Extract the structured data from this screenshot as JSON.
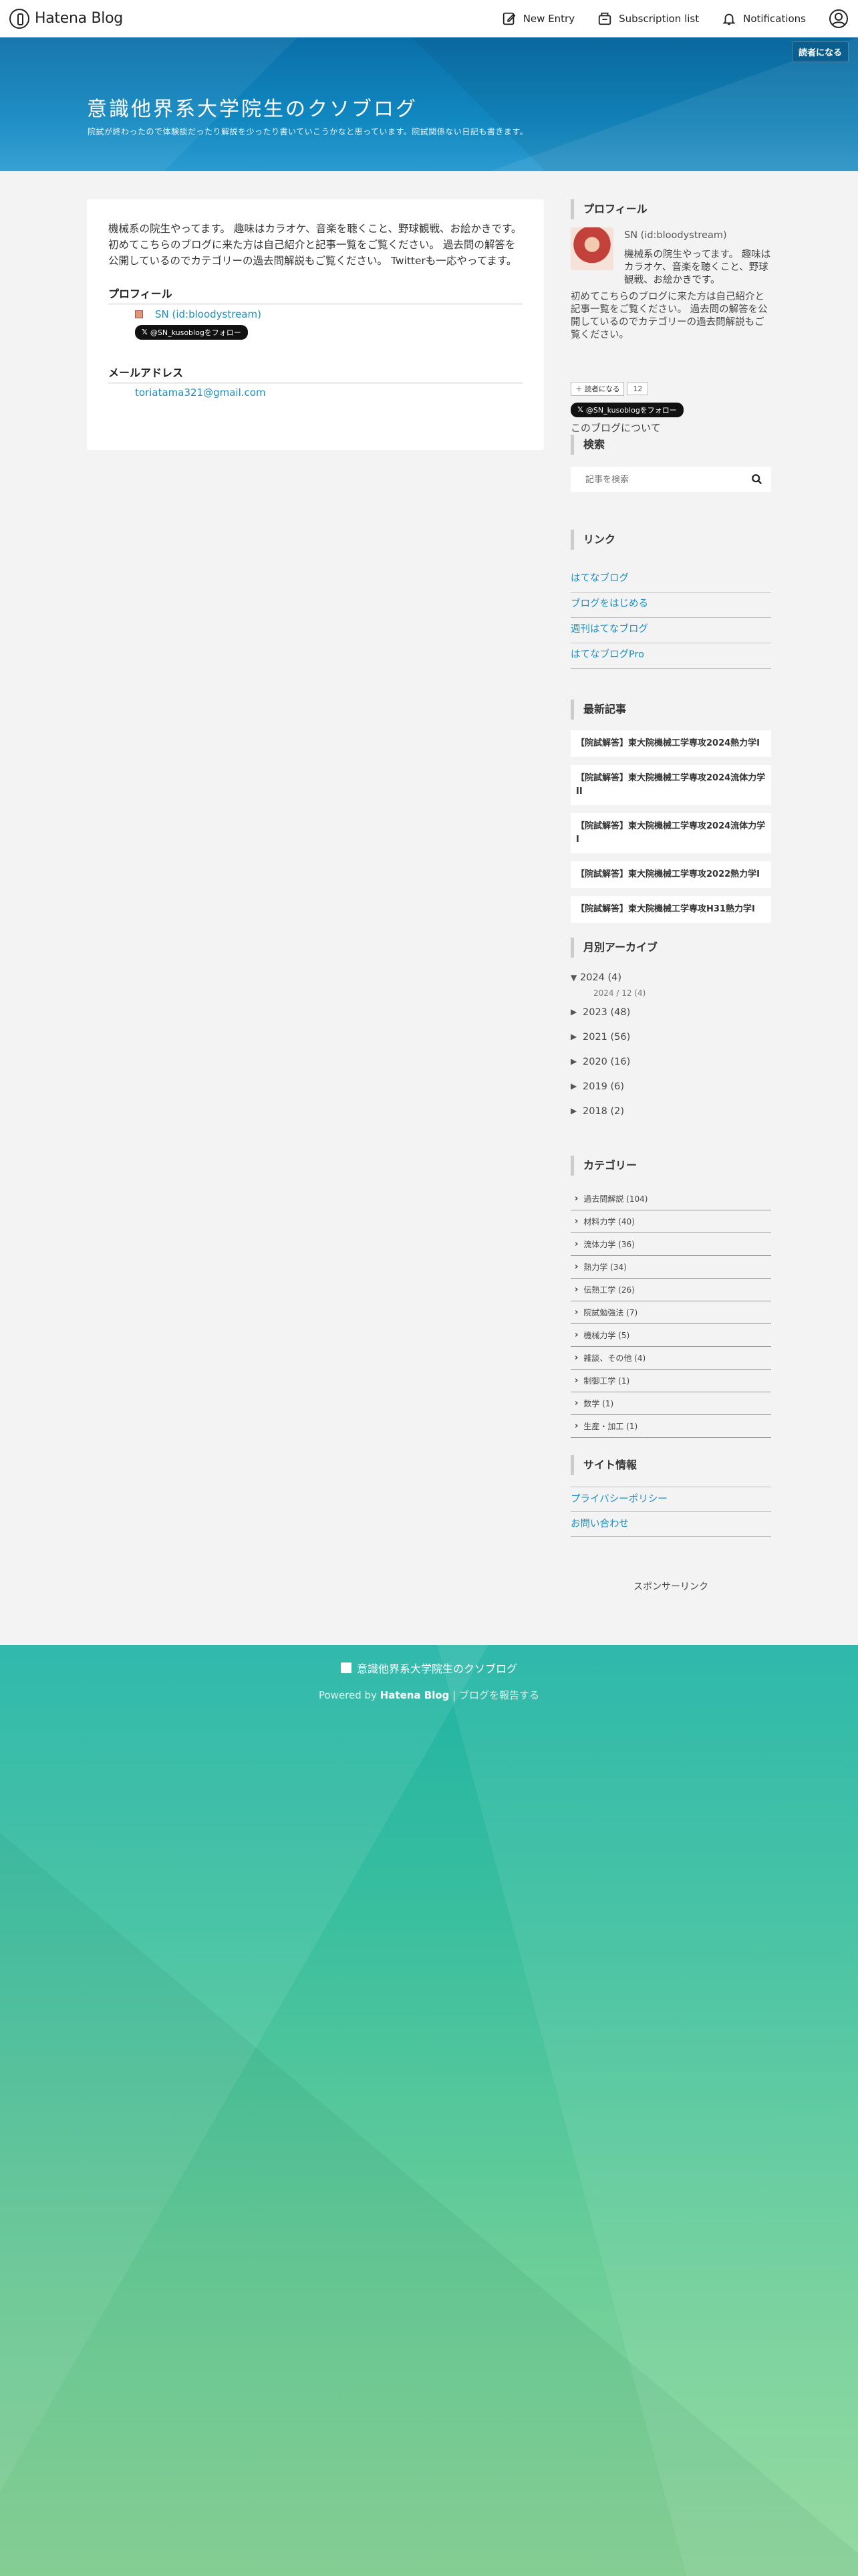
{
  "global_header": {
    "logo_text": "Hatena Blog",
    "new_entry": "New Entry",
    "subscription": "Subscription list",
    "notifications": "Notifications"
  },
  "blog_header": {
    "reader_button": "読者になる",
    "title": "意識他界系大学院生のクソブログ",
    "description": "院試が終わったので体験談だったり解説を少ったり書いていこうかなと思っています。院試関係ない日記も書きます。"
  },
  "main": {
    "about_text": "機械系の院生やってます。 趣味はカラオケ、音楽を聴くこと、野球観戦、お絵かきです。 初めてこちらのブログに来た方は自己紹介と記事一覧をご覧ください。 過去問の解答を公開しているのでカテゴリーの過去問解説もご覧ください。 Twitterも一応やってます。",
    "profile_heading": "プロフィール",
    "profile_link": "SN (id:bloodystream)",
    "x_follow": "@SN_kusoblogをフォロー",
    "email_heading": "メールアドレス",
    "email": "toriatama321@gmail.com"
  },
  "sidebar": {
    "profile": {
      "heading": "プロフィール",
      "name": "SN (id:bloodystream)",
      "text1": "機械系の院生やってます。 趣味はカラオケ、音楽を聴くこと、野球観戦、お絵かきです。",
      "text2": "初めてこちらのブログに来た方は自己紹介と記事一覧をご覧ください。 過去問の解答を公開しているのでカテゴリーの過去問解説もご覧ください。",
      "reader_button": "読者になる",
      "reader_count": "12",
      "x_follow": "@SN_kusoblogをフォロー",
      "about_blog": "このブログについて"
    },
    "search": {
      "heading": "検索",
      "placeholder": "記事を検索"
    },
    "links": {
      "heading": "リンク",
      "items": [
        "はてなブログ",
        "ブログをはじめる",
        "週刊はてなブログ",
        "はてなブログPro"
      ]
    },
    "recent": {
      "heading": "最新記事",
      "items": [
        "【院試解答】東大院機械工学専攻2024熱力学I",
        "【院試解答】東大院機械工学専攻2024流体力学II",
        "【院試解答】東大院機械工学専攻2024流体力学I",
        "【院試解答】東大院機械工学専攻2022熱力学I",
        "【院試解答】東大院機械工学専攻H31熱力学I"
      ]
    },
    "archive": {
      "heading": "月別アーカイブ",
      "open": "▼",
      "closed": "▶",
      "items": [
        "2024 (4)",
        "2023 (48)",
        "2021 (56)",
        "2020 (16)",
        "2019 (6)",
        "2018 (2)"
      ],
      "sub_item": "2024 / 12 (4)"
    },
    "categories": {
      "heading": "カテゴリー",
      "items": [
        "過去問解説 (104)",
        "材料力学 (40)",
        "流体力学 (36)",
        "熱力学 (34)",
        "伝熱工学 (26)",
        "院試勉強法 (7)",
        "機械力学 (5)",
        "雑談、その他 (4)",
        "制御工学 (1)",
        "数学 (1)",
        "生産・加工 (1)"
      ]
    },
    "site_info": {
      "heading": "サイト情報",
      "items": [
        "プライバシーポリシー",
        "お問い合わせ"
      ]
    },
    "sponsor": "スポンサーリンク"
  },
  "footer": {
    "title": "意識他界系大学院生のクソブログ",
    "powered_prefix": "Powered by",
    "powered_brand": "Hatena Blog",
    "report": "ブログを報告する"
  },
  "colors": {
    "link": "#1a8fc0",
    "header_blue": "#0a6fa8",
    "footer_green": "#3bbf9e"
  }
}
